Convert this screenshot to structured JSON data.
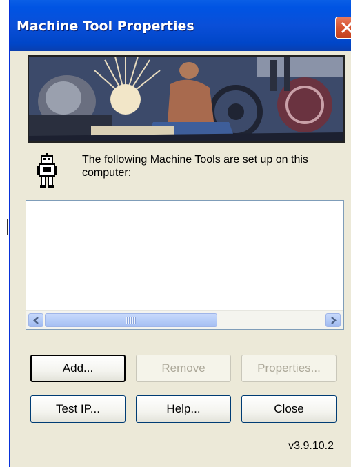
{
  "window": {
    "title": "Machine Tool Properties"
  },
  "intro_text": "The following Machine Tools are set up on this computer:",
  "machine_list": {
    "items": []
  },
  "buttons": {
    "add": "Add...",
    "remove": "Remove",
    "properties": "Properties...",
    "test_ip": "Test IP...",
    "help": "Help...",
    "close": "Close"
  },
  "version": "v3.9.10.2",
  "colors": {
    "titlebar": "#0054e3",
    "window_bg": "#ece9d8",
    "close_button": "#d6532e",
    "scroll_thumb": "#b6cdf8"
  },
  "icons": {
    "close": "close-icon",
    "robot": "robot-icon",
    "scroll_left": "arrow-left-icon",
    "scroll_right": "arrow-right-icon"
  }
}
